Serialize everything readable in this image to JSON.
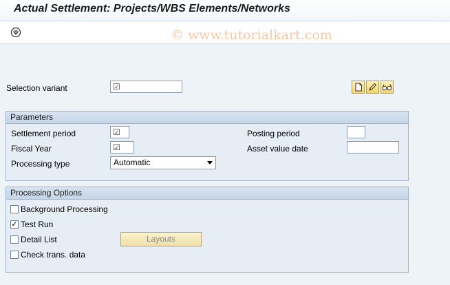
{
  "app": {
    "title": "Actual Settlement: Projects/WBS Elements/Networks",
    "watermark": "© www.tutorialkart.com"
  },
  "toolbar": {
    "execute_icon": "execute-icon"
  },
  "selection_variant": {
    "label": "Selection variant",
    "value": "",
    "required_mark": "☑",
    "buttons": [
      {
        "icon": "new-document-icon"
      },
      {
        "icon": "edit-pencil-icon"
      },
      {
        "icon": "display-glasses-icon"
      }
    ]
  },
  "parameters": {
    "title": "Parameters",
    "settlement_period": {
      "label": "Settlement period",
      "value": "",
      "required_mark": "☑"
    },
    "fiscal_year": {
      "label": "Fiscal Year",
      "value": "",
      "required_mark": "☑"
    },
    "processing_type": {
      "label": "Processing type",
      "value": "Automatic"
    },
    "posting_period": {
      "label": "Posting period",
      "value": ""
    },
    "asset_value_date": {
      "label": "Asset value date",
      "value": ""
    }
  },
  "processing_options": {
    "title": "Processing Options",
    "background_processing": {
      "label": "Background Processing",
      "checked": false,
      "mark": ""
    },
    "test_run": {
      "label": "Test Run",
      "checked": true,
      "mark": "✓"
    },
    "detail_list": {
      "label": "Detail List",
      "checked": false,
      "mark": ""
    },
    "check_trans_data": {
      "label": "Check trans. data",
      "checked": false,
      "mark": ""
    },
    "layouts_button": "Layouts"
  }
}
